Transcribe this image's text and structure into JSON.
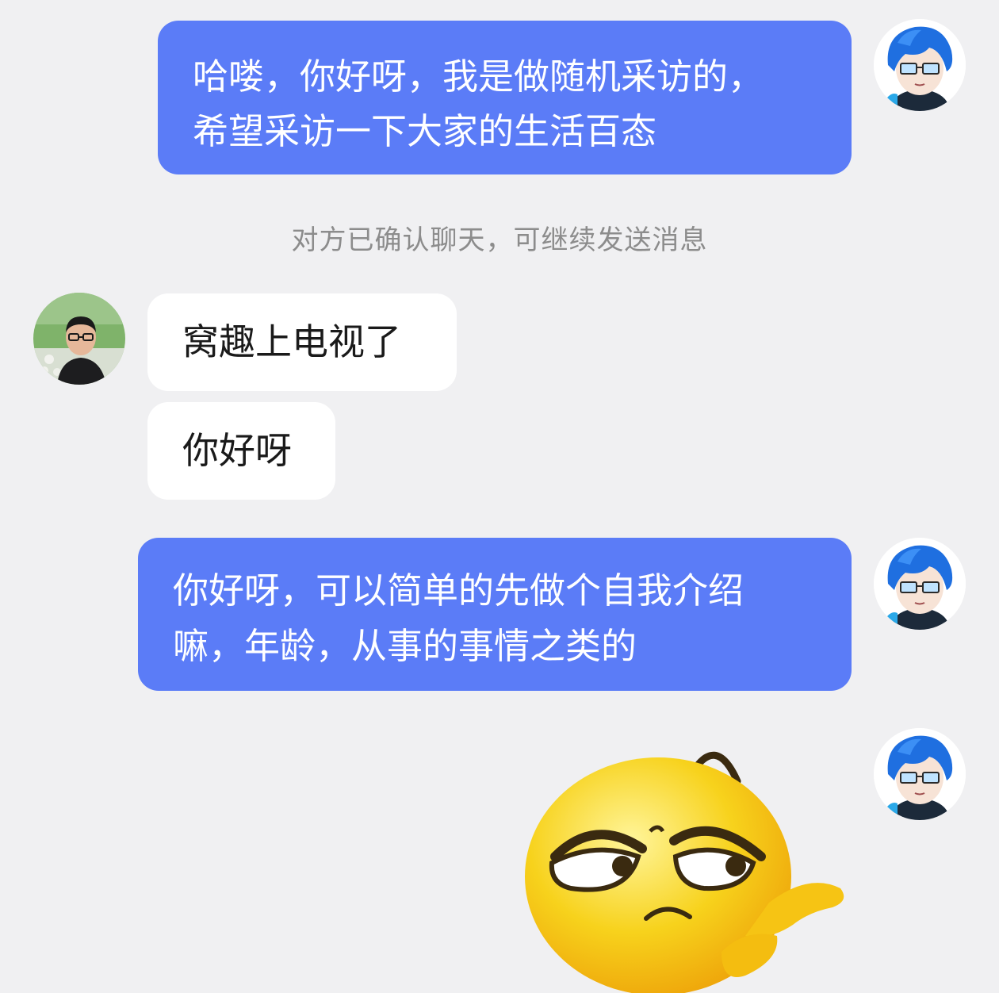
{
  "theme": {
    "outgoing_bubble": "#5b7cf7",
    "incoming_bubble": "#ffffff",
    "background": "#f0f0f2",
    "system_text": "#8c8c8c"
  },
  "messages": [
    {
      "side": "me",
      "text": "哈喽，你好呀，我是做随机采访的，\n希望采访一下大家的生活百态"
    },
    {
      "side": "system",
      "text": "对方已确认聊天，可继续发送消息"
    },
    {
      "side": "other",
      "text": "窝趣上电视了"
    },
    {
      "side": "other",
      "text": "你好呀"
    },
    {
      "side": "me",
      "text": "你好呀，可以简单的先做个自我介绍\n嘛，年龄，从事的事情之类的"
    },
    {
      "side": "me",
      "sticker": "squinting-yellow-emoji-pointing-sticker"
    }
  ],
  "avatars": {
    "me": "anime-boy-blue-hair-glasses-avatar",
    "other": "man-with-glasses-photo-avatar"
  }
}
